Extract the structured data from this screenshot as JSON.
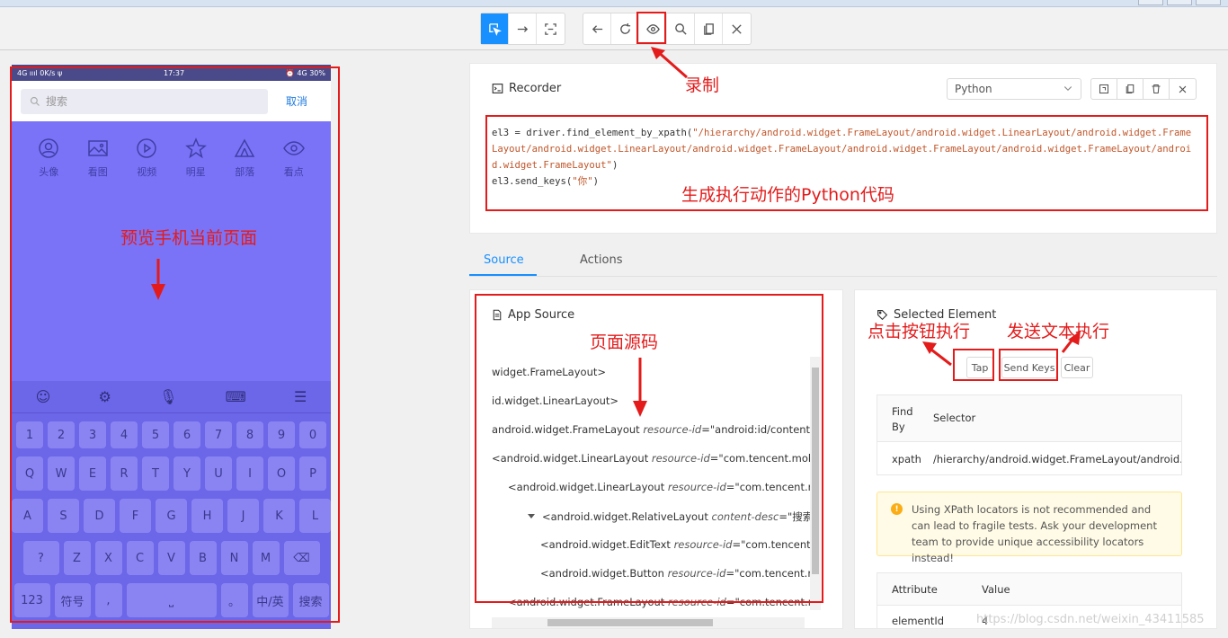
{
  "toolbar": {
    "groups": [
      {
        "icons": [
          "select-element-icon",
          "swipe-icon",
          "tap-coordinates-icon"
        ]
      },
      {
        "icons": [
          "back-icon",
          "refresh-icon",
          "record-eye-icon",
          "search-icon",
          "copy-icon",
          "close-icon"
        ]
      }
    ]
  },
  "phone": {
    "status_left": "4G ıııl  0K/s ψ",
    "status_time": "17:37",
    "status_right": "⏰ 4G 30%",
    "search_placeholder": "搜索",
    "cancel_label": "取消",
    "quick_items": [
      {
        "label": "头像",
        "icon": "avatar-icon"
      },
      {
        "label": "看图",
        "icon": "image-icon"
      },
      {
        "label": "视频",
        "icon": "video-icon"
      },
      {
        "label": "明星",
        "icon": "star-icon"
      },
      {
        "label": "部落",
        "icon": "tent-icon"
      },
      {
        "label": "看点",
        "icon": "eye-icon"
      }
    ],
    "kb_top": [
      "☺",
      "⚙",
      "🎙",
      "⌨",
      "☰"
    ],
    "row_num": [
      "1",
      "2",
      "3",
      "4",
      "5",
      "6",
      "7",
      "8",
      "9",
      "0"
    ],
    "row_q": [
      "Q",
      "W",
      "E",
      "R",
      "T",
      "Y",
      "U",
      "I",
      "O",
      "P"
    ],
    "row_a": [
      "A",
      "S",
      "D",
      "F",
      "G",
      "H",
      "J",
      "K",
      "L"
    ],
    "row_z": [
      "?",
      "Z",
      "X",
      "C",
      "V",
      "B",
      "N",
      "M",
      "⌫"
    ],
    "row_bottom": [
      "123",
      "符号",
      ",",
      "⎵",
      "。",
      "中/英",
      "搜索"
    ]
  },
  "annotations": {
    "record": "录制",
    "python_code": "生成执行动作的Python代码",
    "preview": "预览手机当前页面",
    "page_source": "页面源码",
    "tap_exec": "点击按钮执行",
    "send_exec": "发送文本执行"
  },
  "recorder": {
    "title": "Recorder",
    "language": "Python",
    "code_line1_pre": "el3 = driver.find_element_by_xpath(",
    "code_line1_str": "\"/hierarchy/android.widget.FrameLayout/android.widget.LinearLayout/android.widget.FrameLayout/android.widget.LinearLayout/android.widget.FrameLayout/android.widget.FrameLayout/android.widget.FrameLayout/android.widget.FrameLayout\"",
    "code_line1_post": ")",
    "code_line2_pre": "el3.send_keys(",
    "code_line2_str": "\"你\"",
    "code_line2_post": ")"
  },
  "tabs": [
    {
      "label": "Source",
      "active": true
    },
    {
      "label": "Actions",
      "active": false
    }
  ],
  "source": {
    "title": "App Source",
    "nodes": [
      {
        "text": "widget.FrameLayout>"
      },
      {
        "text": "id.widget.LinearLayout>"
      },
      {
        "text": "android.widget.FrameLayout ",
        "attr": "resource-id",
        "val": "\"android:id/content\">"
      },
      {
        "text": "<android.widget.LinearLayout ",
        "attr": "resource-id",
        "val": "\"com.tencent.mobileqq"
      },
      {
        "text": "<android.widget.LinearLayout ",
        "attr": "resource-id",
        "val": "\"com.tencent.mobile"
      },
      {
        "text": "<android.widget.RelativeLayout ",
        "attr": "content-desc",
        "val": "\"搜索聊天或者"
      },
      {
        "text": "<android.widget.EditText ",
        "attr": "resource-id",
        "val": "\"com.tencent.mob"
      },
      {
        "text": "<android.widget.Button ",
        "attr": "resource-id",
        "val": "\"com.tencent.mobil"
      },
      {
        "text": "<android.widget.FrameLayout ",
        "attr": "resource-id",
        "val": "\"com.tencent.mobile"
      }
    ]
  },
  "selected": {
    "title": "Selected Element",
    "tap_label": "Tap",
    "send_keys_label": "Send Keys",
    "clear_label": "Clear",
    "find_by_header": "Find By",
    "selector_header": "Selector",
    "find_by_value": "xpath",
    "selector_value": "/hierarchy/android.widget.FrameLayout/android.widget.L",
    "warning": "Using XPath locators is not recommended and can lead to fragile tests. Ask your development team to provide unique accessibility locators instead!",
    "attr_header": "Attribute",
    "value_header": "Value",
    "attr_name": "elementId",
    "attr_value": "4"
  },
  "watermark": "https://blog.csdn.net/weixin_43411585",
  "colors": {
    "accent": "#1890ff",
    "annotation": "#e31b1b",
    "phone_overlay": "#7b73f7"
  }
}
